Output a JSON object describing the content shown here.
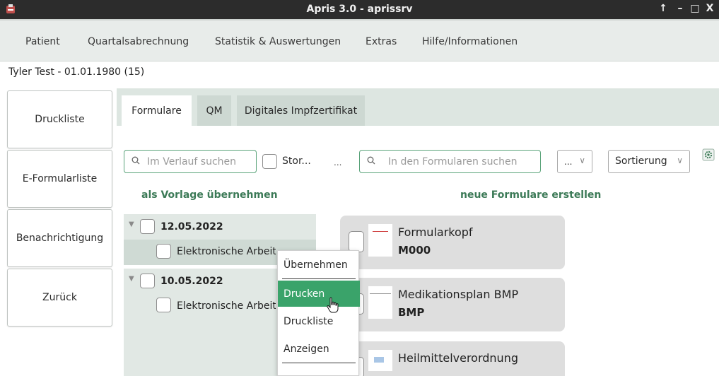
{
  "window": {
    "title": "Apris 3.0 - aprissrv",
    "controls": [
      "↑",
      "–",
      "□",
      "X"
    ]
  },
  "menu": [
    "Patient",
    "Quartalsabrechnung",
    "Statistik & Auswertungen",
    "Extras",
    "Hilfe/Informationen"
  ],
  "patient": "Tyler Test - 01.01.1980 (15)",
  "sidebar": [
    "Druckliste",
    "E-Formularliste",
    "Benachrichtigung",
    "Zurück"
  ],
  "tabs": [
    "Formulare",
    "QM",
    "Digitales Impfzertifikat"
  ],
  "active_tab": "Formulare",
  "history_search": {
    "placeholder": "Im Verlauf suchen"
  },
  "storno_label": "Stor...",
  "ellipsis": "...",
  "forms_search": {
    "placeholder": "In den Formularen suchen"
  },
  "filter_dropdown": {
    "value": "...",
    "chevron": "∨"
  },
  "sort_dropdown": {
    "value": "Sortierung",
    "chevron": "∨"
  },
  "left_heading": "als Vorlage übernehmen",
  "right_heading": "neue Formulare erstellen",
  "history": [
    {
      "date": "12.05.2022",
      "entry": "Elektronische Arbeitsunfähig"
    },
    {
      "date": "10.05.2022",
      "entry": "Elektronische Arbeitsunfähig"
    }
  ],
  "forms": [
    {
      "name": "Formularkopf",
      "code": "M000"
    },
    {
      "name": "Medikationsplan BMP",
      "code": "BMP"
    },
    {
      "name": "Heilmittelverordnung",
      "code": ""
    }
  ],
  "context_menu": {
    "items": [
      "Übernehmen",
      "Drucken",
      "Druckliste",
      "Anzeigen"
    ],
    "highlighted": "Drucken"
  },
  "colors": {
    "accent": "#3aa36a",
    "heading_green": "#3c7a57",
    "titlebar": "#2c2c2c"
  },
  "icons": [
    "app-icon",
    "search-icon",
    "settings-icon",
    "expand-triangle-icon",
    "hand-cursor-icon"
  ]
}
